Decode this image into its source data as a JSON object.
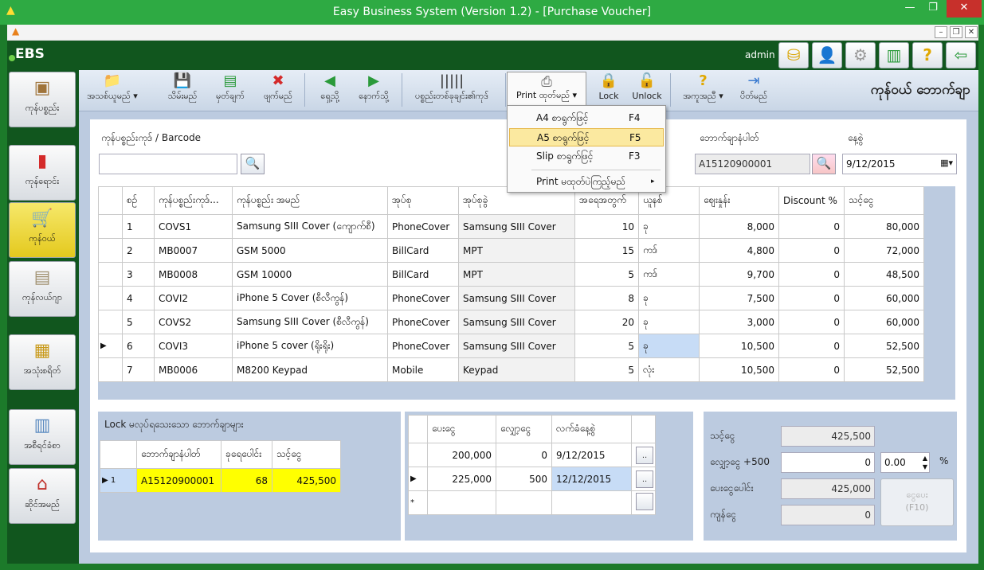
{
  "window": {
    "title": "Easy Business System  (Version 1.2) - [Purchase Voucher]"
  },
  "header": {
    "logo": "EBS",
    "user": "admin"
  },
  "sidebar": {
    "items": [
      {
        "label": "ကုန်ပစ္စည်း"
      },
      {
        "label": "ကုန်ရောင်း"
      },
      {
        "label": "ကုန်ဝယ်"
      },
      {
        "label": "ကုန်လယ်ဂျာ"
      },
      {
        "label": "အသုံးစရိတ်"
      },
      {
        "label": "အစီရင်ခံစာ"
      },
      {
        "label": "ဆိုင်အမည်"
      }
    ]
  },
  "toolbar": {
    "new": "အသစ်ယူမည်",
    "save": "သိမ်းမည်",
    "note": "မှတ်ချက်",
    "delete": "ဖျက်မည်",
    "prev": "ရှေ့သို့",
    "next": "နောက်သို့",
    "barcode": "ပစ္စည်းတစ်ခုချင်း၏ကုဒ်",
    "print": "Print ထုတ်မည်",
    "lock": "Lock",
    "unlock": "Unlock",
    "help": "အကူအညီ",
    "exit": "ပိတ်မည်",
    "page_title": "ကုန်ဝယ် ဘောက်ချာ"
  },
  "print_menu": [
    {
      "label": "A4 စာရွက်ဖြင့်",
      "key": "F4"
    },
    {
      "label": "A5 စာရွက်ဖြင့်",
      "key": "F5"
    },
    {
      "label": "Slip စာရွက်ဖြင့်",
      "key": "F3"
    },
    {
      "label": "Print မထုတ်ပဲကြည့်မည်",
      "key": "▸"
    }
  ],
  "form": {
    "barcode_label": "ကုန်ပစ္စည်းကုဒ် / Barcode",
    "barcode_value": "",
    "voucher_label": "ဘောက်ချာနံပါတ်",
    "voucher_value": "A15120900001",
    "date_label": "နေ့စွဲ",
    "date_value": "9/12/2015"
  },
  "items_table": {
    "headers": [
      "စဉ်",
      "ကုန်ပစ္စည်းကုဒ်...",
      "ကုန်ပစ္စည်း အမည်",
      "အုပ်စု",
      "အုပ်စုခွဲ",
      "အရေအတွက်",
      "ယူနစ်",
      "ဈေးနှုန်း",
      "Discount %",
      "သင့်ငွေ"
    ],
    "rows": [
      [
        "1",
        "COVS1",
        "Samsung SIII Cover (ကျောက်စီ)",
        "PhoneCover",
        "Samsung SIII Cover",
        "10",
        "ခု",
        "8,000",
        "0",
        "80,000"
      ],
      [
        "2",
        "MB0007",
        "GSM 5000",
        "BillCard",
        "MPT",
        "15",
        "ကဒ်",
        "4,800",
        "0",
        "72,000"
      ],
      [
        "3",
        "MB0008",
        "GSM 10000",
        "BillCard",
        "MPT",
        "5",
        "ကဒ်",
        "9,700",
        "0",
        "48,500"
      ],
      [
        "4",
        "COVI2",
        "iPhone 5 Cover (စီလီကွန်)",
        "PhoneCover",
        "Samsung SIII Cover",
        "8",
        "ခု",
        "7,500",
        "0",
        "60,000"
      ],
      [
        "5",
        "COVS2",
        "Samsung SIII Cover (စီလီကွန်)",
        "PhoneCover",
        "Samsung SIII Cover",
        "20",
        "ခု",
        "3,000",
        "0",
        "60,000"
      ],
      [
        "6",
        "COVI3",
        "iPhone 5 cover (ရိုးရိုး)",
        "PhoneCover",
        "Samsung SIII Cover",
        "5",
        "ခု",
        "10,500",
        "0",
        "52,500"
      ],
      [
        "7",
        "MB0006",
        "M8200 Keypad",
        "Mobile",
        "Keypad",
        "5",
        "လုံး",
        "10,500",
        "0",
        "52,500"
      ]
    ]
  },
  "locked_panel": {
    "title": "Lock မလုပ်ရသေးသော ဘောက်ချာများ",
    "headers": [
      "ဘောက်ချာနံပါတ်",
      "ခုရေပေါင်း",
      "သင့်ငွေ"
    ],
    "rows": [
      [
        "1",
        "A15120900001",
        "68",
        "425,500"
      ]
    ]
  },
  "payments_table": {
    "headers": [
      "ပေးငွေ",
      "လျှော့ငွေ",
      "လက်ခံနေ့စွဲ"
    ],
    "rows": [
      [
        "200,000",
        "0",
        "9/12/2015"
      ],
      [
        "225,000",
        "500",
        "12/12/2015"
      ]
    ],
    "new_row_marker": "*",
    "btn": ".."
  },
  "totals": {
    "total_label": "သင့်ငွေ",
    "total_value": "425,500",
    "discount_label": "လျှော့ငွေ +500",
    "discount_value": "0",
    "discount_pct": "0.00",
    "pct_sign": "%",
    "paid_label": "ပေးငွေပေါင်း",
    "paid_value": "425,000",
    "balance_label": "ကျန်ငွေ",
    "balance_value": "0",
    "pay_btn": "ငွေပေး",
    "pay_key": "(F10)"
  },
  "colors": {
    "title_green": "#2eaa43",
    "dark_green": "#11561e",
    "panel": "#bccbe0",
    "highlight": "#ffff00",
    "selected": "#c7dcf6"
  }
}
